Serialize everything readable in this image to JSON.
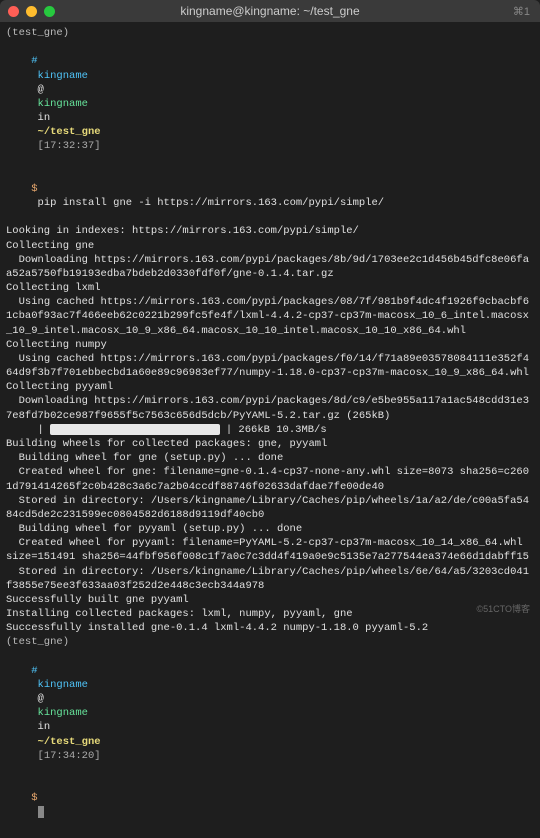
{
  "window": {
    "title": "kingname@kingname: ~/test_gne",
    "shortcut": "⌘1"
  },
  "prompt1": {
    "env": "(test_gne)",
    "hash": "#",
    "user": "kingname",
    "at": "@",
    "host": "kingname",
    "in": "in",
    "path": "~/test_gne",
    "time": "[17:32:37]",
    "dollar": "$",
    "command": "pip install gne -i https://mirrors.163.com/pypi/simple/"
  },
  "output": {
    "l01": "Looking in indexes: https://mirrors.163.com/pypi/simple/",
    "l02": "Collecting gne",
    "l03": "  Downloading https://mirrors.163.com/pypi/packages/8b/9d/1703ee2c1d456b45dfc8e06faa52a5750fb19193edba7bdeb2d0330fdf0f/gne-0.1.4.tar.gz",
    "l04": "Collecting lxml",
    "l05": "  Using cached https://mirrors.163.com/pypi/packages/08/7f/981b9f4dc4f1926f9cbacbf61cba0f93ac7f466eeb62c0221b299fc5fe4f/lxml-4.4.2-cp37-cp37m-macosx_10_6_intel.macosx_10_9_intel.macosx_10_9_x86_64.macosx_10_10_intel.macosx_10_10_x86_64.whl",
    "l06": "Collecting numpy",
    "l07": "  Using cached https://mirrors.163.com/pypi/packages/f0/14/f71a89e03578084111e352f464d9f3b7f701ebbecbd1a60e89c96983ef77/numpy-1.18.0-cp37-cp37m-macosx_10_9_x86_64.whl",
    "l08": "Collecting pyyaml",
    "l09": "  Downloading https://mirrors.163.com/pypi/packages/8d/c9/e5be955a117a1ac548cdd31e37e8fd7b02ce987f9655f5c7563c656d5dcb/PyYAML-5.2.tar.gz (265kB)",
    "l10a": "     |",
    "l10b": "| 266kB 10.3MB/s",
    "l11": "Building wheels for collected packages: gne, pyyaml",
    "l12": "  Building wheel for gne (setup.py) ... done",
    "l13": "  Created wheel for gne: filename=gne-0.1.4-cp37-none-any.whl size=8073 sha256=c2601d791414265f2c0b428c3a6c7a2b04ccdf88746f02633dafdae7fe00de40",
    "l14": "  Stored in directory: /Users/kingname/Library/Caches/pip/wheels/1a/a2/de/c00a5fa5484cd5de2c231599ec0804582d6188d9119df40cb0",
    "l15": "  Building wheel for pyyaml (setup.py) ... done",
    "l16": "  Created wheel for pyyaml: filename=PyYAML-5.2-cp37-cp37m-macosx_10_14_x86_64.whl size=151491 sha256=44fbf956f008c1f7a0c7c3dd4f419a0e9c5135e7a277544ea374e66d1dabff15",
    "l17": "  Stored in directory: /Users/kingname/Library/Caches/pip/wheels/6e/64/a5/3203cd041f3855e75ee3f633aa03f252d2e448c3ecb344a978",
    "l18": "Successfully built gne pyyaml",
    "l19": "Installing collected packages: lxml, numpy, pyyaml, gne",
    "l20": "Successfully installed gne-0.1.4 lxml-4.4.2 numpy-1.18.0 pyyaml-5.2"
  },
  "prompt2": {
    "env": "(test_gne)",
    "hash": "#",
    "user": "kingname",
    "at": "@",
    "host": "kingname",
    "in": "in",
    "path": "~/test_gne",
    "time": "[17:34:20]",
    "dollar": "$"
  },
  "watermark": "©51CTO博客"
}
